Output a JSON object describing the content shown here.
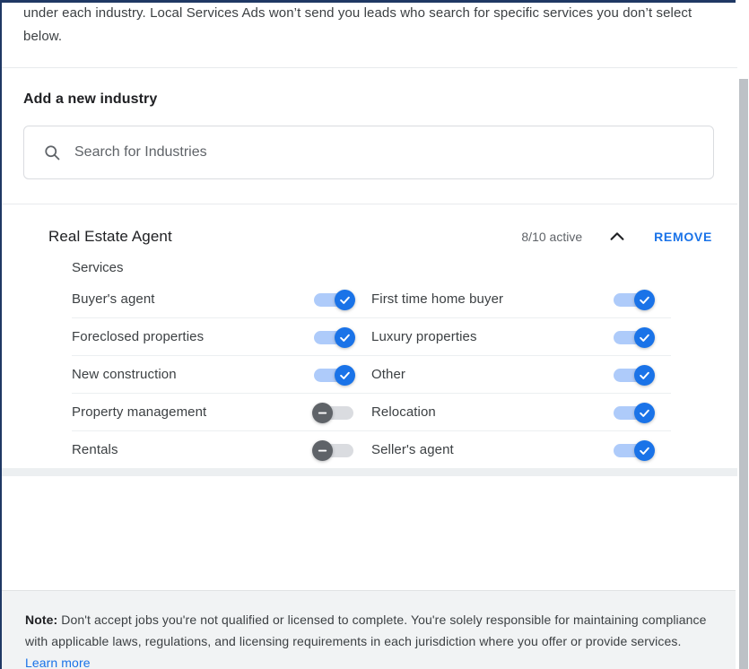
{
  "intro": {
    "paragraph": "under each industry. Local Services Ads won’t send you leads who search for specific services you don’t select below."
  },
  "add_industry": {
    "heading": "Add a new industry",
    "search_placeholder": "Search for Industries",
    "search_value": "",
    "search_icon": "search-icon"
  },
  "industry": {
    "title": "Real Estate Agent",
    "active_count": "8/10 active",
    "collapse_icon": "chevron-up-icon",
    "remove_label": "REMOVE",
    "services_label": "Services",
    "rows": [
      {
        "left": {
          "name": "Buyer's agent",
          "on": true
        },
        "right": {
          "name": "First time home buyer",
          "on": true
        }
      },
      {
        "left": {
          "name": "Foreclosed properties",
          "on": true
        },
        "right": {
          "name": "Luxury properties",
          "on": true
        }
      },
      {
        "left": {
          "name": "New construction",
          "on": true
        },
        "right": {
          "name": "Other",
          "on": true
        }
      },
      {
        "left": {
          "name": "Property management",
          "on": false
        },
        "right": {
          "name": "Relocation",
          "on": true
        }
      },
      {
        "left": {
          "name": "Rentals",
          "on": false
        },
        "right": {
          "name": "Seller's agent",
          "on": true
        }
      }
    ]
  },
  "note": {
    "label": "Note:",
    "body": " Don't accept jobs you're not qualified or licensed to complete. You're solely responsible for maintaining compliance with applicable laws, regulations, and licensing requirements in each jurisdiction where you offer or provide services. ",
    "link_label": "Learn more"
  },
  "colors": {
    "accent_blue": "#1a73e8",
    "toggle_on_track": "#aecbfa",
    "toggle_off_thumb": "#5f6368",
    "toggle_off_track": "#dadce0",
    "note_background": "#f1f3f4",
    "focus_frame": "#1f3864"
  }
}
